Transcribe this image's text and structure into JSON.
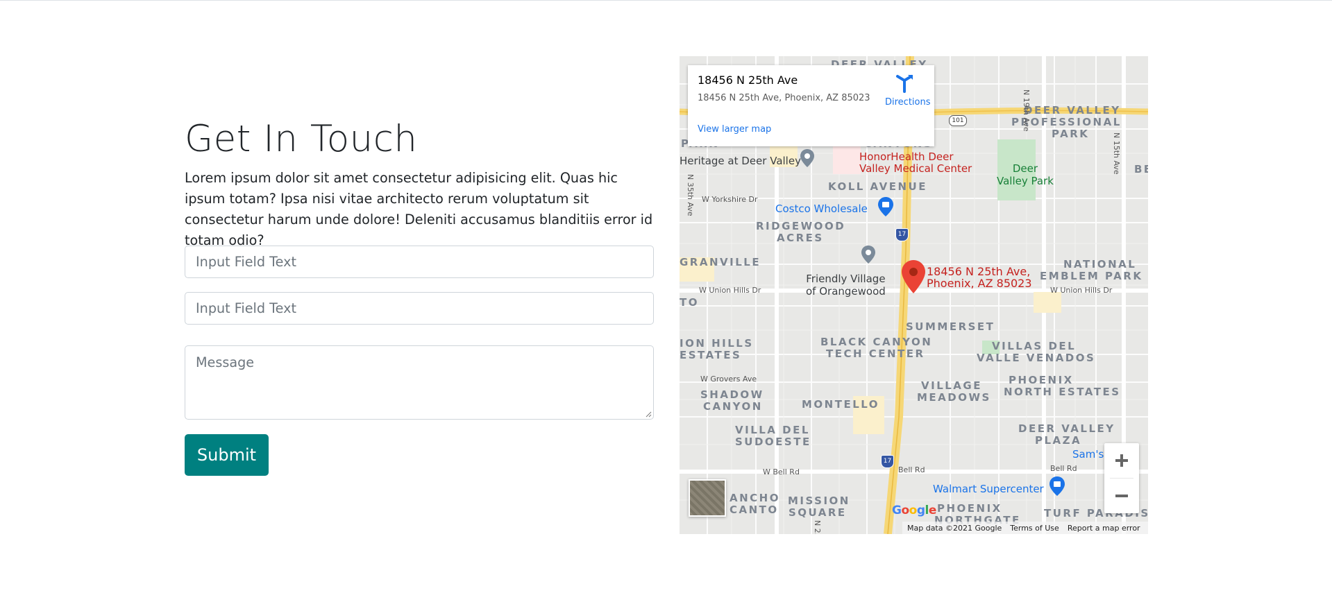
{
  "heading": "Get In Touch",
  "description": "Lorem ipsum dolor sit amet consectetur adipisicing elit. Quas hic ipsum totam? Ipsa nisi vitae architecto rerum voluptatum sit consectetur harum unde dolore! Deleniti accusamus blanditiis error id totam odio?",
  "form": {
    "field1_placeholder": "Input Field Text",
    "field2_placeholder": "Input Field Text",
    "message_placeholder": "Message",
    "submit_label": "Submit",
    "submit_color": "#008080"
  },
  "map": {
    "card": {
      "title": "18456 N 25th Ave",
      "address": "18456 N 25th Ave, Phoenix, AZ 85023",
      "directions_label": "Directions",
      "larger_map_label": "View larger map"
    },
    "pin_label_line1": "18456 N 25th Ave,",
    "pin_label_line2": "Phoenix, AZ 85023",
    "areas": {
      "deer_valley_top": "DEER VALLEY",
      "deer_valley_pp_1": "DEER VALLEY",
      "deer_valley_pp_2": "PROFESSIONAL",
      "deer_valley_pp_3": "PARK",
      "canyons": "CANYONS",
      "park": "PARK",
      "koll_avenue": "KOLL AVENUE",
      "ridgewood_1": "RIDGEWOOD",
      "ridgewood_2": "ACRES",
      "granville": "GRANVILLE",
      "national_1": "NATIONAL",
      "national_2": "EMBLEM PARK",
      "summerset": "SUMMERSET",
      "black_canyon_1": "BLACK CANYON",
      "black_canyon_2": "TECH CENTER",
      "villas_1": "VILLAS DEL",
      "villas_2": "VALLE VENADOS",
      "ion_hills_1": "ION HILLS",
      "ion_hills_2": "ESTATES",
      "phoenix_north_1": "PHOENIX",
      "phoenix_north_2": "NORTH ESTATES",
      "village_1": "VILLAGE",
      "village_2": "MEADOWS",
      "shadow_1": "SHADOW",
      "shadow_2": "CANYON",
      "montello": "MONTELLO",
      "dv_plaza_1": "DEER VALLEY",
      "dv_plaza_2": "PLAZA",
      "villa_1": "VILLA DEL",
      "villa_2": "SUDOESTE",
      "ancho_1": "ANCHO",
      "ancho_2": "CANTO",
      "mission_1": "MISSION",
      "mission_2": "SQUARE",
      "phoenix_ng_1": "PHOENIX",
      "phoenix_ng_2": "NORTHGATE",
      "turf": "TURF PARADIS",
      "to": "TO",
      "be": "BE"
    },
    "streets": {
      "n19th": "N 19th Ave",
      "n15th": "N 15th Ave",
      "n35th": "N 35th Ave",
      "n25th": "N 25th Ave",
      "yorkshire": "W Yorkshire Dr",
      "union_hills_w": "W Union Hills Dr",
      "union_hills_e": "W Union Hills Dr",
      "grovers": "W Grovers Ave",
      "bell_w": "W Bell Rd",
      "bell_c": "Bell Rd",
      "bell_e": "Bell Rd",
      "i17_a": "17",
      "i17_b": "17",
      "route101": "101"
    },
    "pois": {
      "heritage": "Heritage at Deer Valley",
      "honorhealth_1": "HonorHealth Deer",
      "honorhealth_2": "Valley Medical Center",
      "costco": "Costco Wholesale",
      "friendly_1": "Friendly Village",
      "friendly_2": "of Orangewood",
      "deer_valley_park_1": "Deer",
      "deer_valley_park_2": "Valley Park",
      "walmart": "Walmart Supercenter",
      "sams": "Sam's"
    },
    "google_logo": "Google",
    "footer": {
      "map_data": "Map data ©2021 Google",
      "terms": "Terms of Use",
      "report": "Report a map error"
    },
    "zoom_in_symbol": "+",
    "zoom_out_symbol": "−"
  }
}
